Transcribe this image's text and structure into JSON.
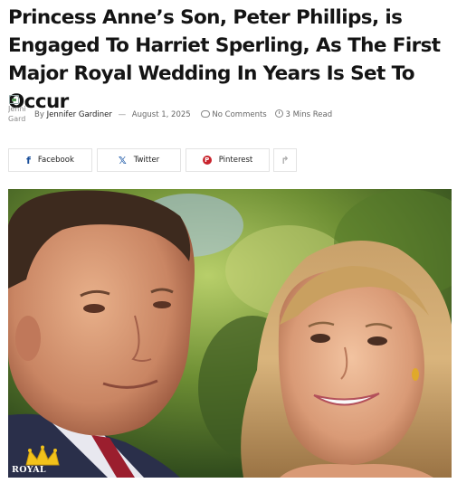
{
  "article": {
    "title": "Princess Anne’s Son, Peter Phillips, is Engaged To Harriet Sperling, As The First Major Royal Wedding In Years Is Set To Occur"
  },
  "meta": {
    "avatar_alt": "Jenni\nGard",
    "by_label": "By",
    "author": "Jennifer Gardiner",
    "date": "August 1, 2025",
    "comments": "No Comments",
    "read_time": "3 Mins Read"
  },
  "share": {
    "facebook": {
      "label": "Facebook",
      "icon": "facebook-icon"
    },
    "twitter": {
      "label": "Twitter",
      "icon": "x-icon"
    },
    "pinterest": {
      "label": "Pinterest",
      "icon": "pinterest-icon"
    },
    "more": {
      "icon": "share-arrow-icon"
    }
  },
  "image": {
    "watermark": "ROYAL",
    "watermark_color": "#f2c21b"
  }
}
